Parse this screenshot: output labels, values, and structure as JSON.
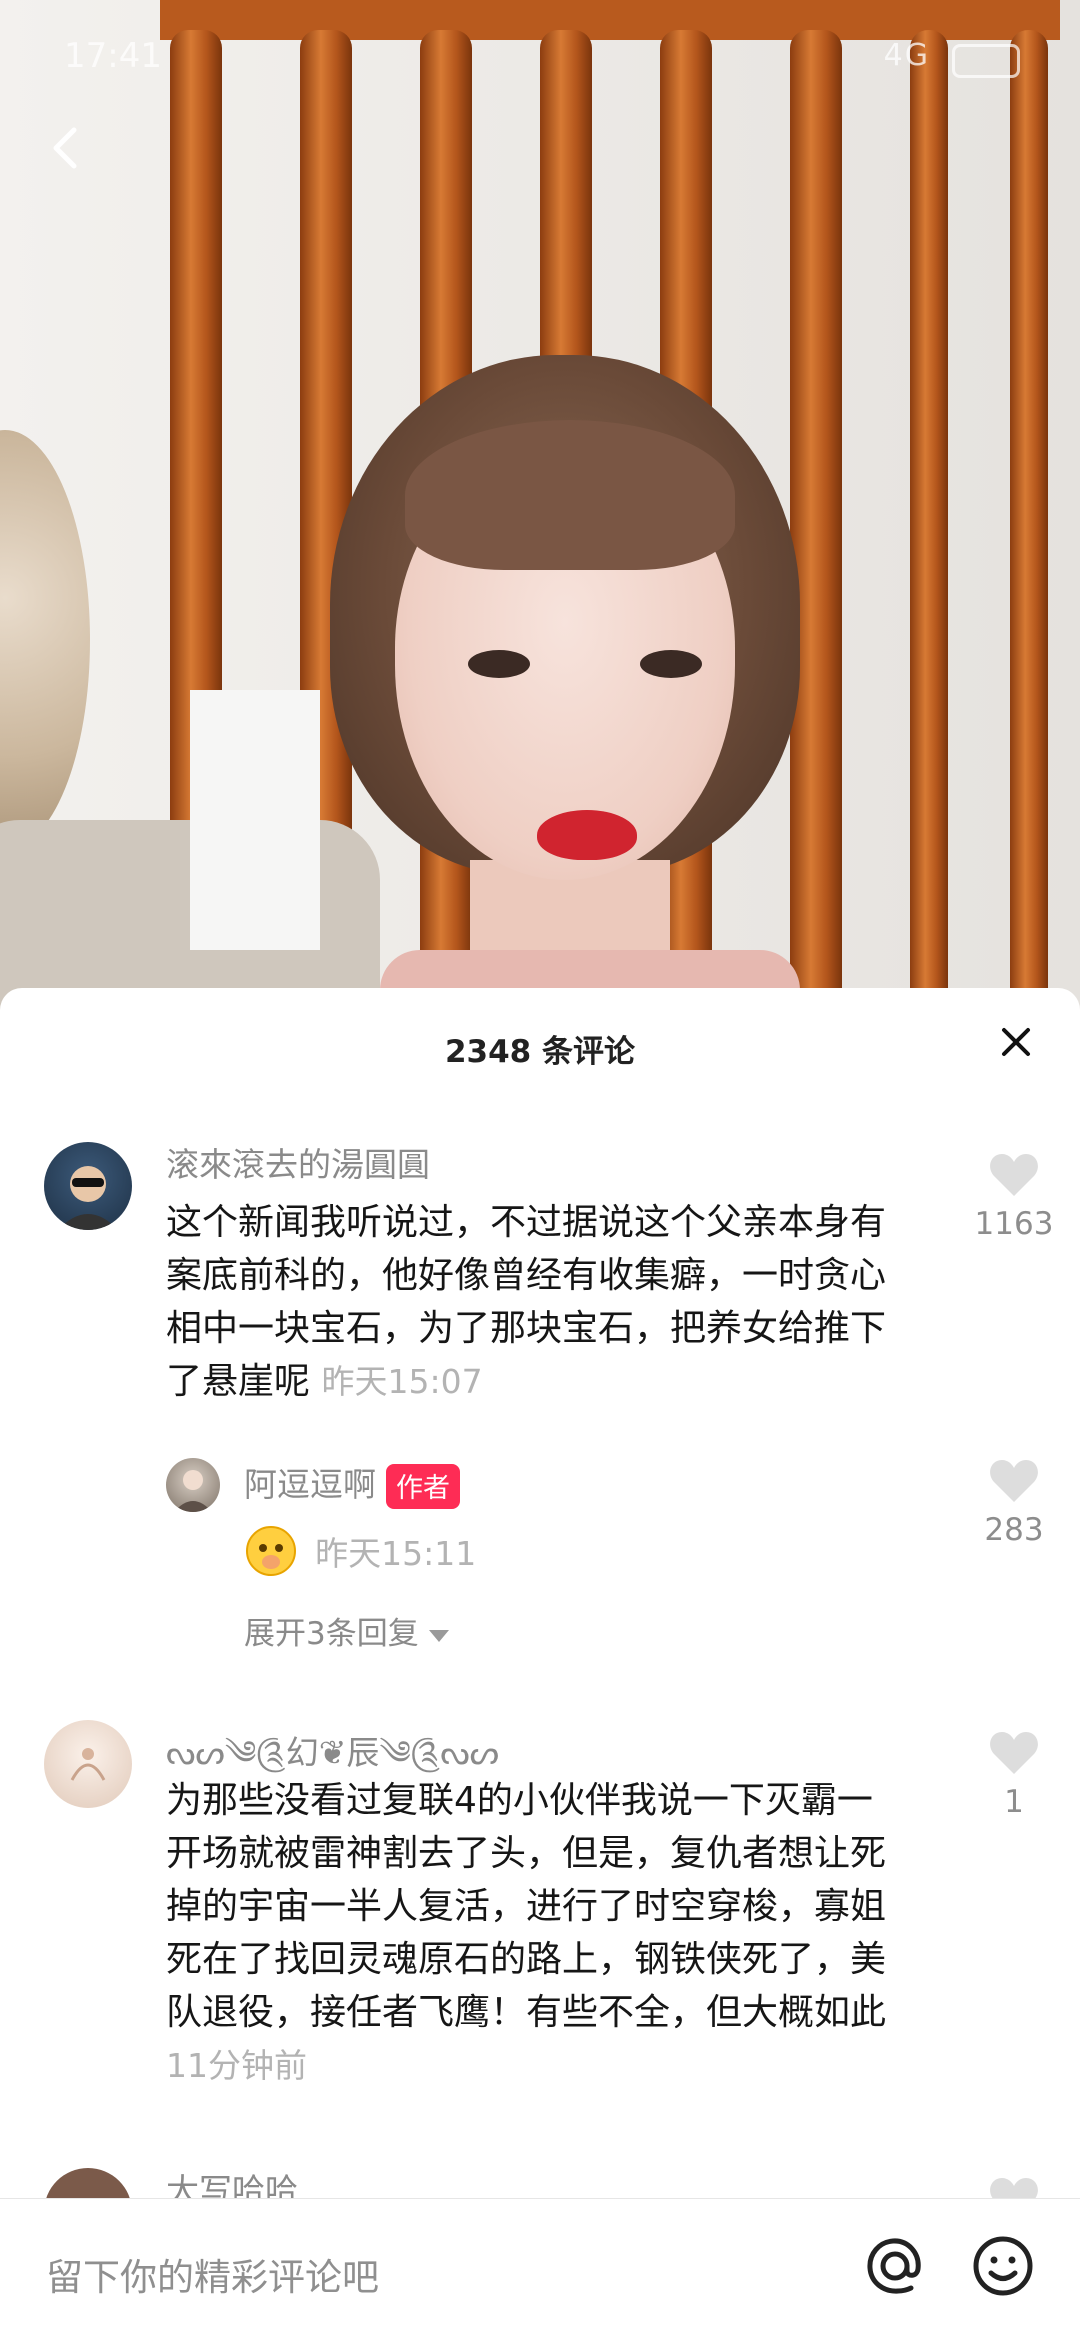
{
  "status_bar": {
    "time": "17:41",
    "network": "4G"
  },
  "sheet": {
    "title": "2348 条评论",
    "input_placeholder": "留下你的精彩评论吧"
  },
  "comments": [
    {
      "username": "滚來滾去的湯圓圓",
      "text": "这个新闻我听说过，不过据说这个父亲本身有案底前科的，他好像曾经有收集癖，一时贪心相中一块宝石，为了那块宝石，把养女给推下了悬崖呢",
      "time": "昨天15:07",
      "likes": "1163"
    },
    {
      "username": "阿逗逗啊",
      "badge": "作者",
      "time": "昨天15:11",
      "likes": "283",
      "expand": "展开3条回复"
    },
    {
      "username": "ᔓᔕ༄༊幻❦辰༄༊ᔓᔕ",
      "text": "为那些没看过复联4的小伙伴我说一下灭霸一开场就被雷神割去了头，但是，复仇者想让死掉的宇宙一半人复活，进行了时空穿梭，寡姐死在了找回灵魂原石的路上，钢铁侠死了，美队退役，接任者飞鹰！有些不全，但大概如此",
      "time": "11分钟前",
      "likes": "1"
    },
    {
      "username": "大写哈哈"
    }
  ]
}
